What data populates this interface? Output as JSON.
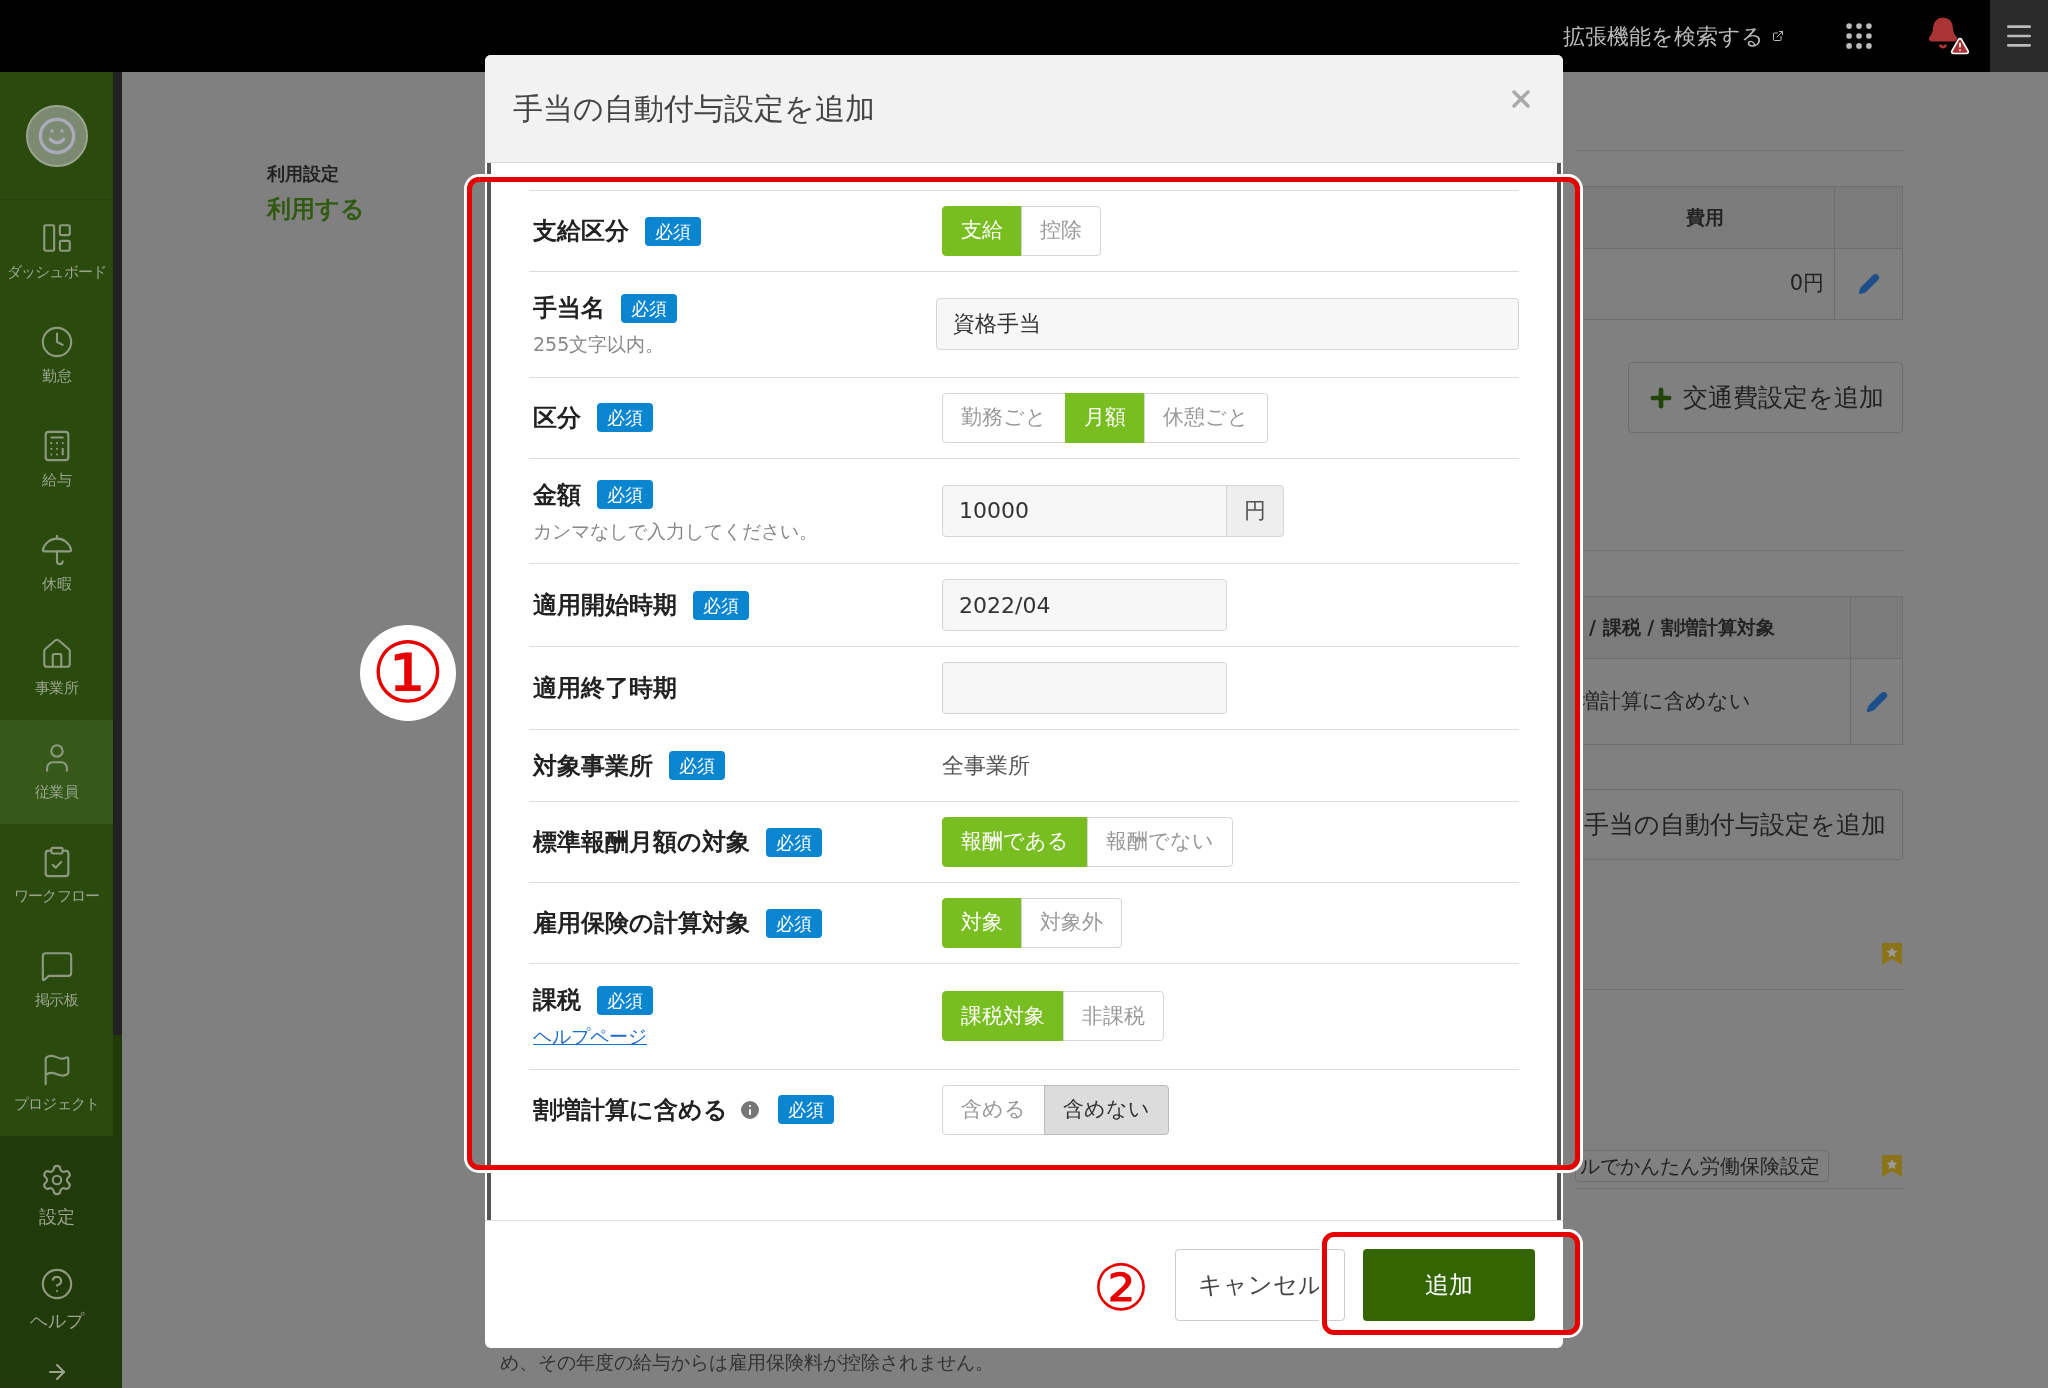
{
  "header": {
    "search_link": "拡張機能を検索する"
  },
  "sidebar": {
    "items": [
      {
        "label": "ダッシュボード",
        "selected": false
      },
      {
        "label": "勤怠",
        "selected": false
      },
      {
        "label": "給与",
        "selected": false
      },
      {
        "label": "休暇",
        "selected": false
      },
      {
        "label": "事業所",
        "selected": false
      },
      {
        "label": "従業員",
        "selected": true
      },
      {
        "label": "ワークフロー",
        "selected": false
      },
      {
        "label": "掲示板",
        "selected": false
      },
      {
        "label": "プロジェクト",
        "selected": false
      }
    ],
    "footer_items": [
      {
        "label": "設定"
      },
      {
        "label": "ヘルプ"
      }
    ]
  },
  "page": {
    "setting": {
      "label": "利用設定",
      "value": "利用する"
    },
    "table_1": {
      "columns": [
        "費用"
      ],
      "rows": [
        [
          "0円"
        ]
      ]
    },
    "add_transport_button": "交通費設定を追加",
    "table_2": {
      "columns": [
        "/ 課税 / 割増計算対象"
      ],
      "rows": [
        [
          "増計算に含めない"
        ]
      ]
    },
    "add_allowance_button": "手当の自動付与設定を追加",
    "tag": "ルでかんたん労働保険設定",
    "footer_text": "め、その年度の給与からは雇用保険料が控除されません。"
  },
  "dialog": {
    "title": "手当の自動付与設定を追加",
    "fields": [
      {
        "label": "支給区分",
        "badge": "必須",
        "kind": "toggle",
        "options": [
          {
            "label": "支給",
            "selected": true
          },
          {
            "label": "控除",
            "selected": false
          }
        ]
      },
      {
        "label": "手当名",
        "badge": "必須",
        "note": "255文字以内。",
        "kind": "input",
        "value": "資格手当"
      },
      {
        "label": "区分",
        "badge": "必須",
        "kind": "toggle",
        "options": [
          {
            "label": "勤務ごと",
            "selected": false
          },
          {
            "label": "月額",
            "selected": true
          },
          {
            "label": "休憩ごと",
            "selected": false
          }
        ]
      },
      {
        "label": "金額",
        "badge": "必須",
        "note": "カンマなしで入力してください。",
        "kind": "input_unit",
        "value": "10000",
        "unit": "円"
      },
      {
        "label": "適用開始時期",
        "badge": "必須",
        "kind": "date",
        "value": "2022/04"
      },
      {
        "label": "適用終了時期",
        "kind": "date"
      },
      {
        "label": "対象事業所",
        "badge": "必須",
        "kind": "text",
        "value": "全事業所"
      },
      {
        "label": "標準報酬月額の対象",
        "badge": "必須",
        "kind": "toggle",
        "options": [
          {
            "label": "報酬である",
            "selected": true
          },
          {
            "label": "報酬でない",
            "selected": false
          }
        ]
      },
      {
        "label": "雇用保険の計算対象",
        "badge": "必須",
        "kind": "toggle",
        "options": [
          {
            "label": "対象",
            "selected": true
          },
          {
            "label": "対象外",
            "selected": false
          }
        ]
      },
      {
        "label": "課税",
        "badge": "必須",
        "help_link": "ヘルプページ",
        "kind": "toggle",
        "options": [
          {
            "label": "課税対象",
            "selected": true
          },
          {
            "label": "非課税",
            "selected": false
          }
        ]
      },
      {
        "label": "割増計算に含める",
        "badge": "必須",
        "info": true,
        "kind": "toggle_plain",
        "options": [
          {
            "label": "含める",
            "selected": false
          },
          {
            "label": "含めない",
            "selected": true
          }
        ]
      }
    ],
    "buttons": {
      "cancel": "キャンセル",
      "submit": "追加"
    }
  },
  "annotations": [
    {
      "label": "①"
    },
    {
      "label": "②"
    }
  ]
}
